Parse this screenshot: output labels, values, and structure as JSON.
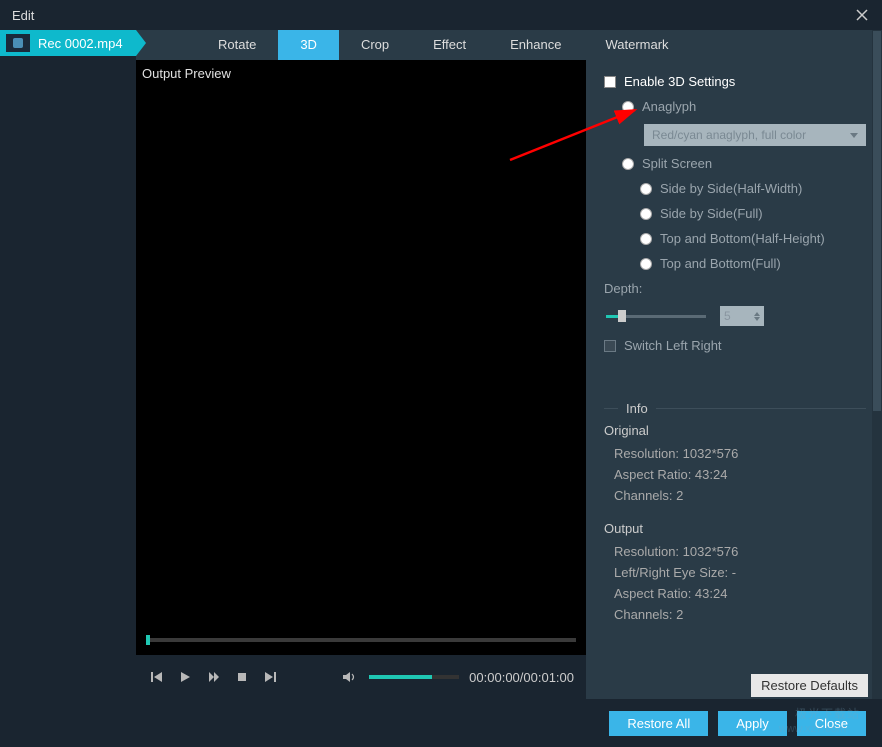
{
  "title": "Edit",
  "file": {
    "name": "Rec 0002.mp4"
  },
  "tabs": {
    "rotate": "Rotate",
    "three_d": "3D",
    "crop": "Crop",
    "effect": "Effect",
    "enhance": "Enhance",
    "watermark": "Watermark"
  },
  "preview": {
    "label": "Output Preview"
  },
  "time": {
    "display": "00:00:00/00:01:00"
  },
  "settings": {
    "enable3d": "Enable 3D Settings",
    "anaglyph": "Anaglyph",
    "anaglyph_option": "Red/cyan anaglyph, full color",
    "split_screen": "Split Screen",
    "sbs_half": "Side by Side(Half-Width)",
    "sbs_full": "Side by Side(Full)",
    "tb_half": "Top and Bottom(Half-Height)",
    "tb_full": "Top and Bottom(Full)",
    "depth_label": "Depth:",
    "depth_value": "5",
    "switch_lr": "Switch Left Right"
  },
  "info": {
    "header": "Info",
    "original": {
      "title": "Original",
      "resolution": "Resolution: 1032*576",
      "aspect": "Aspect Ratio: 43:24",
      "channels": "Channels: 2"
    },
    "output": {
      "title": "Output",
      "resolution": "Resolution: 1032*576",
      "eye_size": "Left/Right Eye Size: -",
      "aspect": "Aspect Ratio: 43:24",
      "channels": "Channels: 2"
    }
  },
  "buttons": {
    "restore_defaults": "Restore Defaults",
    "restore_all": "Restore All",
    "apply": "Apply",
    "close": "Close"
  },
  "watermark_overlay": {
    "line1": "极光下载站",
    "line2": "www.xz7.com"
  }
}
